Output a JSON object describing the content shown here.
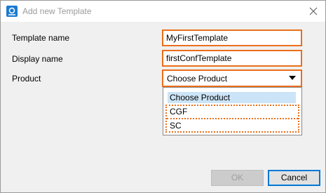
{
  "window": {
    "title": "Add new Template"
  },
  "form": {
    "template_name_label": "Template name",
    "template_name_value": "MyFirstTemplate",
    "display_name_label": "Display name",
    "display_name_value": "firstConfTemplate",
    "product_label": "Product",
    "product_selected": "Choose Product"
  },
  "product_dropdown": {
    "options": [
      "Choose Product",
      "CGF",
      "SC"
    ]
  },
  "buttons": {
    "ok": "OK",
    "cancel": "Cancel"
  },
  "colors": {
    "highlight": "#ea6f1c",
    "selection": "#cce4f7",
    "focus": "#0078d7"
  }
}
